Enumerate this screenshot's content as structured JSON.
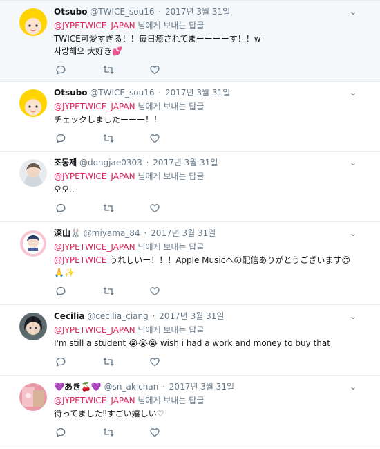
{
  "tweets": [
    {
      "name": "Otsubo",
      "handle": "@TWICE_sou16",
      "time": "2017년 3월 31일",
      "reply_mention": "@JYPETWICE_JAPAN",
      "reply_suffix": "님에게 보내는 답글",
      "text": "TWICE可愛すぎる！！毎日癒されてまーーーーす！！w\n사랑해요 大好き💕",
      "avatar_colors": [
        "#ffd400",
        "#fbe3d2"
      ]
    },
    {
      "name": "Otsubo",
      "handle": "@TWICE_sou16",
      "time": "2017년 3월 31일",
      "reply_mention": "@JYPETWICE_JAPAN",
      "reply_suffix": "님에게 보내는 답글",
      "text": "チェックしましたーーー！！",
      "avatar_colors": [
        "#ffd400",
        "#fbe3d2"
      ]
    },
    {
      "name": "조동제",
      "handle": "@dongjae0303",
      "time": "2017년 3월 31일",
      "reply_mention": "@JYPETWICE_JAPAN",
      "reply_suffix": "님에게 보내는 답글",
      "text": "오오..",
      "avatar_colors": [
        "#6b5a4c",
        "#e8ecef"
      ]
    },
    {
      "name": "深山🐰",
      "handle": "@miyama_84",
      "time": "2017년 3월 31일",
      "reply_mention": "@JYPETWICE_JAPAN",
      "reply_suffix": "님에게 보내는 답글",
      "text_mention": "@JYPETWICE",
      "text": " うれしいー！！！Apple Musicへの配信ありがとうございます😍\n🙏✨",
      "avatar_colors": [
        "#f7c6d4",
        "#2a3a66"
      ]
    },
    {
      "name": "Cecilia",
      "handle": "@cecilia_ciang",
      "time": "2017년 3월 31일",
      "reply_mention": "@JYPETWICE_JAPAN",
      "reply_suffix": "님에게 보내는 답글",
      "text": "I'm still a student 😭😭😭 wish i had a work and money to buy that",
      "avatar_colors": [
        "#1c1e21",
        "#f2d6c4"
      ]
    },
    {
      "name": "💜あき🍒💜",
      "handle": "@sn_akichan",
      "time": "2017년 3월 31일",
      "reply_mention": "@JYPETWICE_JAPAN",
      "reply_suffix": "님에게 보내는 답글",
      "text": "待ってました‼すごい嬉しい♡",
      "avatar_colors": [
        "#e89aa6",
        "#d9b29a"
      ]
    }
  ],
  "separator": "·",
  "caret_icon": "chevron-down-icon",
  "action_icons": [
    "reply-icon",
    "retweet-icon",
    "like-icon"
  ],
  "colors": {
    "mention": "#e0245e",
    "meta": "#657786",
    "border": "#e6ecf0",
    "highlight": "#f5f8fa"
  }
}
